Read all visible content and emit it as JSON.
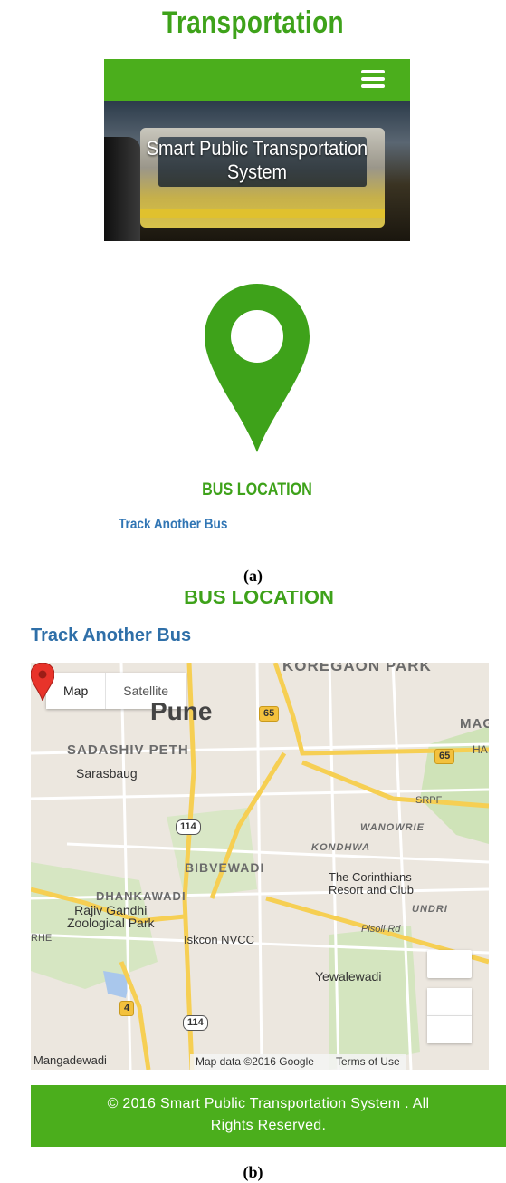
{
  "panel_a": {
    "site_title": "Transportation",
    "hero_title_line1": "Smart Public Transportation",
    "hero_title_line2": "System",
    "bus_location": "BUS LOCATION",
    "track_link": "Track Another Bus",
    "caption": "(a)",
    "icons": [
      "hamburger-menu-icon",
      "location-pin-icon"
    ],
    "accent_color": "#4bae1c",
    "link_color": "#3075b4"
  },
  "panel_b": {
    "bus_location": "BUS LOCATION",
    "track_link": "Track Another Bus",
    "map": {
      "type_buttons": [
        "Map",
        "Satellite"
      ],
      "labels": {
        "koregaon_park": "KOREGAON PARK",
        "pune": "Pune",
        "mag": "MAG",
        "sadashiv_peth": "SADASHIV PETH",
        "sarasbaug": "Sarasbaug",
        "ha": "HA",
        "srpf": "SRPF",
        "wanowrie": "WANOWRIE",
        "kondhwa": "KONDHWA",
        "bibvewadi": "BIBVEWADI",
        "corinthians_1": "The Corinthians",
        "corinthians_2": "Resort and Club",
        "dhankawadi": "DHANKAWADI",
        "undri": "UNDRI",
        "rajiv_1": "Rajiv Gandhi",
        "rajiv_2": "Zoological Park",
        "pisoli": "Pisoli Rd",
        "rhe": "RHE",
        "iskcon": "Iskcon NVCC",
        "yewalewadi": "Yewalewadi",
        "mangadewadi": "Mangadewadi"
      },
      "shields": {
        "nh65_top": "65",
        "nh65_right": "65",
        "sh114_mid": "114",
        "nh4": "4",
        "sh114_bottom": "114"
      },
      "attribution": "Map data ©2016 Google",
      "terms": "Terms of Use",
      "icons": [
        "map-marker-icon",
        "zoom-in-button",
        "zoom-out-button"
      ]
    },
    "footer_line1": "© 2016 Smart Public Transportation System . All",
    "footer_line2": "Rights Reserved.",
    "caption": "(b)"
  }
}
